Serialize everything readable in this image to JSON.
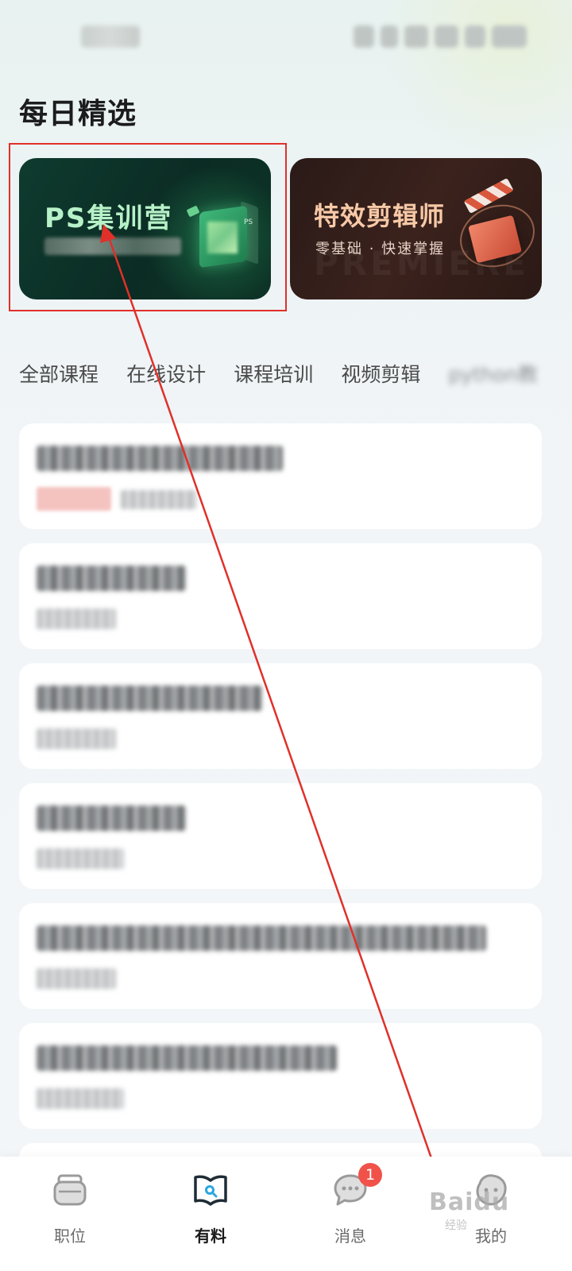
{
  "section": {
    "title": "每日精选"
  },
  "banners": [
    {
      "title": "PS集训营",
      "subtitle": "",
      "icon": "storefront-box-icon"
    },
    {
      "title": "特效剪辑师",
      "subtitle": "零基础 · 快速掌握",
      "background_word": "PREMIERE",
      "icon": "clapperboard-icon"
    }
  ],
  "tabs": [
    {
      "label": "全部课程"
    },
    {
      "label": "在线设计"
    },
    {
      "label": "课程培训"
    },
    {
      "label": "视频剪辑"
    },
    {
      "label": "python教"
    }
  ],
  "bottom_nav": {
    "items": [
      {
        "label": "职位",
        "icon": "briefcase-icon",
        "active": false
      },
      {
        "label": "有料",
        "icon": "open-book-search-icon",
        "active": true
      },
      {
        "label": "消息",
        "icon": "chat-bubble-icon",
        "active": false,
        "badge": "1"
      },
      {
        "label": "我的",
        "icon": "profile-face-icon",
        "active": false
      }
    ]
  },
  "watermark": {
    "text": "Baidu",
    "sub": "经验"
  },
  "colors": {
    "annotation_red": "#e0302a",
    "badge_red": "#f0524a",
    "ps_title": "#b7f1c8",
    "fx_title": "#f7c9a7"
  }
}
